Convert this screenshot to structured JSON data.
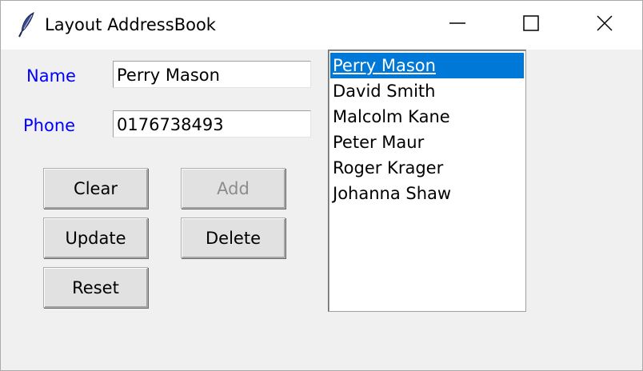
{
  "window": {
    "title": "Layout AddressBook",
    "icon": "feather-icon",
    "controls": [
      "minimize-icon",
      "maximize-icon",
      "close-icon"
    ]
  },
  "form": {
    "name_label": "Name",
    "name_value": "Perry Mason",
    "phone_label": "Phone",
    "phone_value": "0176738493"
  },
  "buttons": {
    "clear": "Clear",
    "add": "Add",
    "update": "Update",
    "delete": "Delete",
    "reset": "Reset"
  },
  "contacts": [
    "Perry Mason",
    "David Smith",
    "Malcolm Kane",
    "Peter Maur",
    "Roger Krager",
    "Johanna Shaw"
  ],
  "selected_contact": "Perry Mason",
  "colors": {
    "label": "#0000ff",
    "selection": "#0078d7",
    "background": "#f0f0f0",
    "disabled_text": "#8c8c8c"
  }
}
